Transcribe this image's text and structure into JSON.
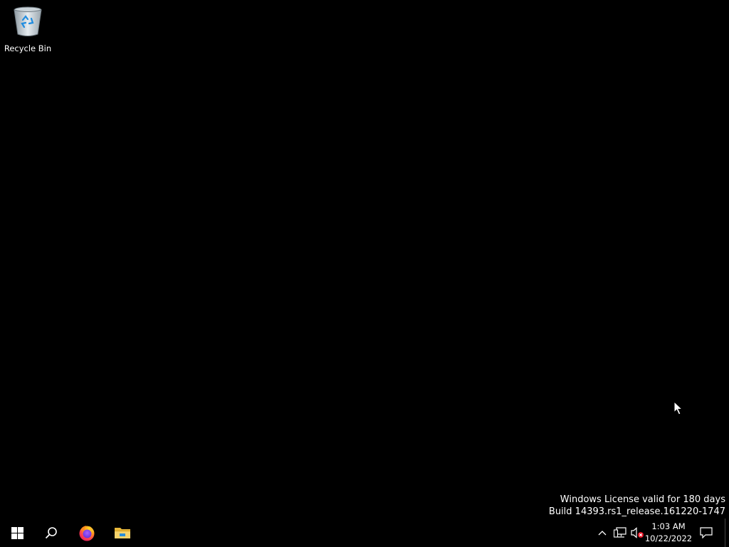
{
  "desktop": {
    "background_color": "#000000",
    "icons": [
      {
        "label": "Recycle Bin",
        "icon": "recycle-bin-icon"
      }
    ],
    "watermark": {
      "line1": "Windows License valid for 180 days",
      "line2": "Build 14393.rs1_release.161220-1747"
    }
  },
  "taskbar": {
    "background_color": "#000000",
    "start_button": {
      "icon": "windows-logo-icon"
    },
    "search_button": {
      "icon": "search-icon"
    },
    "pinned_apps": [
      {
        "name": "Firefox",
        "icon": "firefox-icon"
      },
      {
        "name": "File Explorer",
        "icon": "folder-icon"
      }
    ],
    "tray": {
      "overflow_icon": "chevron-up-icon",
      "network_icon": "network-icon",
      "volume_icon": "volume-muted-icon",
      "clock": {
        "time": "1:03 AM",
        "date": "10/22/2022"
      },
      "notifications_icon": "action-center-icon"
    }
  }
}
